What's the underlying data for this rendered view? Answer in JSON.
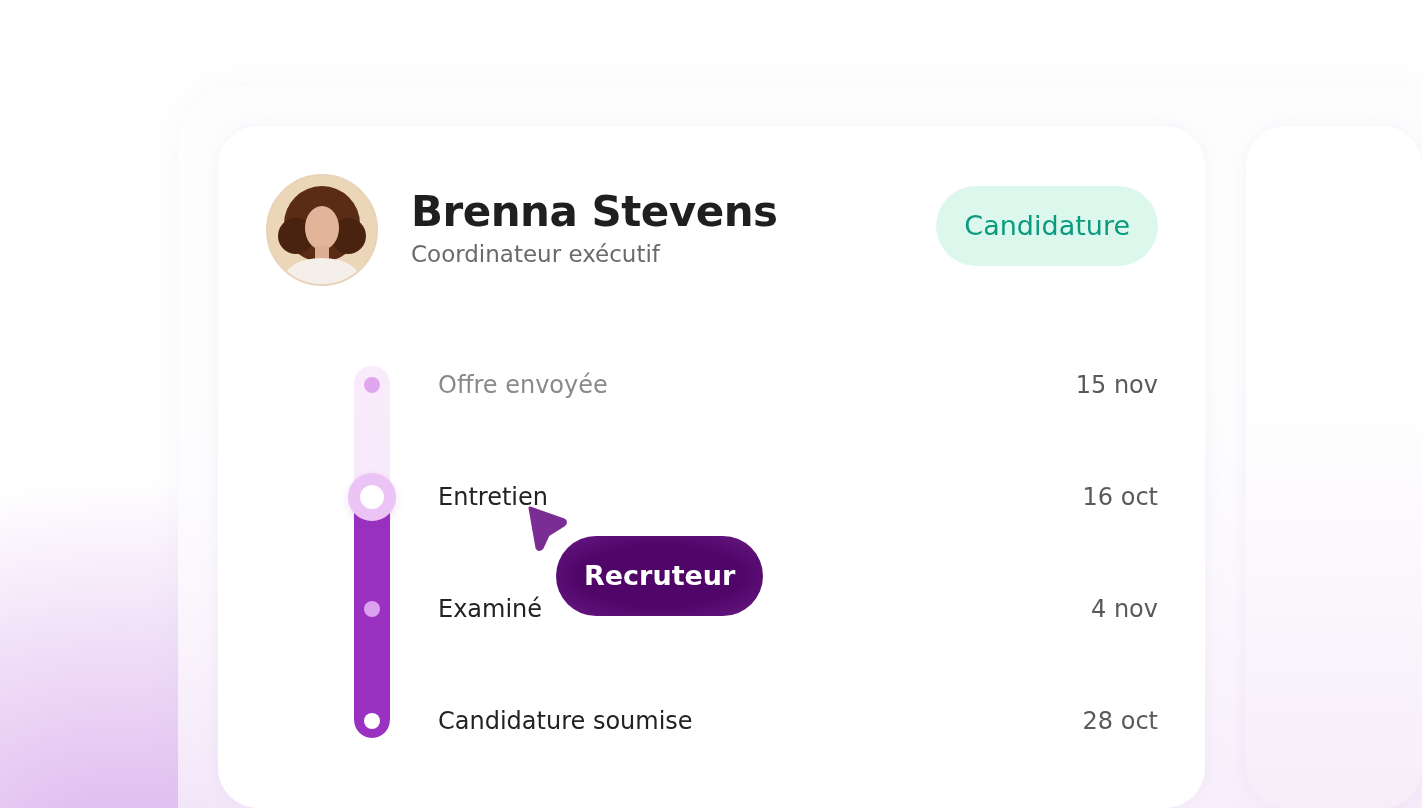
{
  "candidate": {
    "name": "Brenna Stevens",
    "role": "Coordinateur exécutif"
  },
  "status_badge": "Candidature",
  "progress": {
    "level": 0.65
  },
  "steps": [
    {
      "label": "Offre envoyée",
      "date": "15 nov",
      "kind": "pending"
    },
    {
      "label": "Entretien",
      "date": "16 oct",
      "kind": "current"
    },
    {
      "label": "Examiné",
      "date": "4 nov",
      "kind": "done"
    },
    {
      "label": "Candidature soumise",
      "date": "28 oct",
      "kind": "done"
    }
  ],
  "cursor": {
    "label": "Recruteur"
  }
}
